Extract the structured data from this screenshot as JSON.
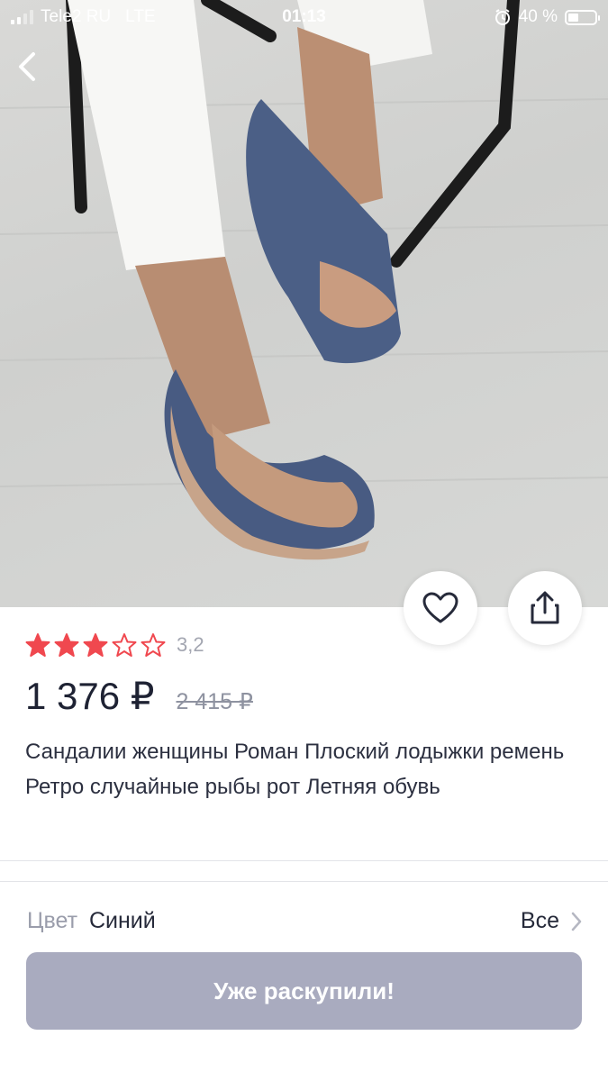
{
  "status_bar": {
    "carrier": "Tele2 RU",
    "network": "LTE",
    "time": "01:13",
    "battery_percent": "40 %",
    "battery_level": 0.4
  },
  "product": {
    "rating": {
      "value": "3,2",
      "stars_filled": 3,
      "stars_total": 5,
      "star_color": "#f0484f"
    },
    "price": "1 376 ₽",
    "old_price": "2 415 ₽",
    "title": "Сандалии женщины Роман Плоский лодыжки ремень Ретро случайные рыбы рот Летняя обувь"
  },
  "variant": {
    "color_label": "Цвет",
    "color_value": "Синий",
    "all_label": "Все"
  },
  "action": {
    "sold_out_label": "Уже раскупили!"
  },
  "icons": {
    "back": "chevron-left-icon",
    "favorite": "heart-icon",
    "share": "share-icon",
    "alarm": "alarm-icon",
    "star": "star-icon",
    "chevron": "chevron-right-icon"
  }
}
